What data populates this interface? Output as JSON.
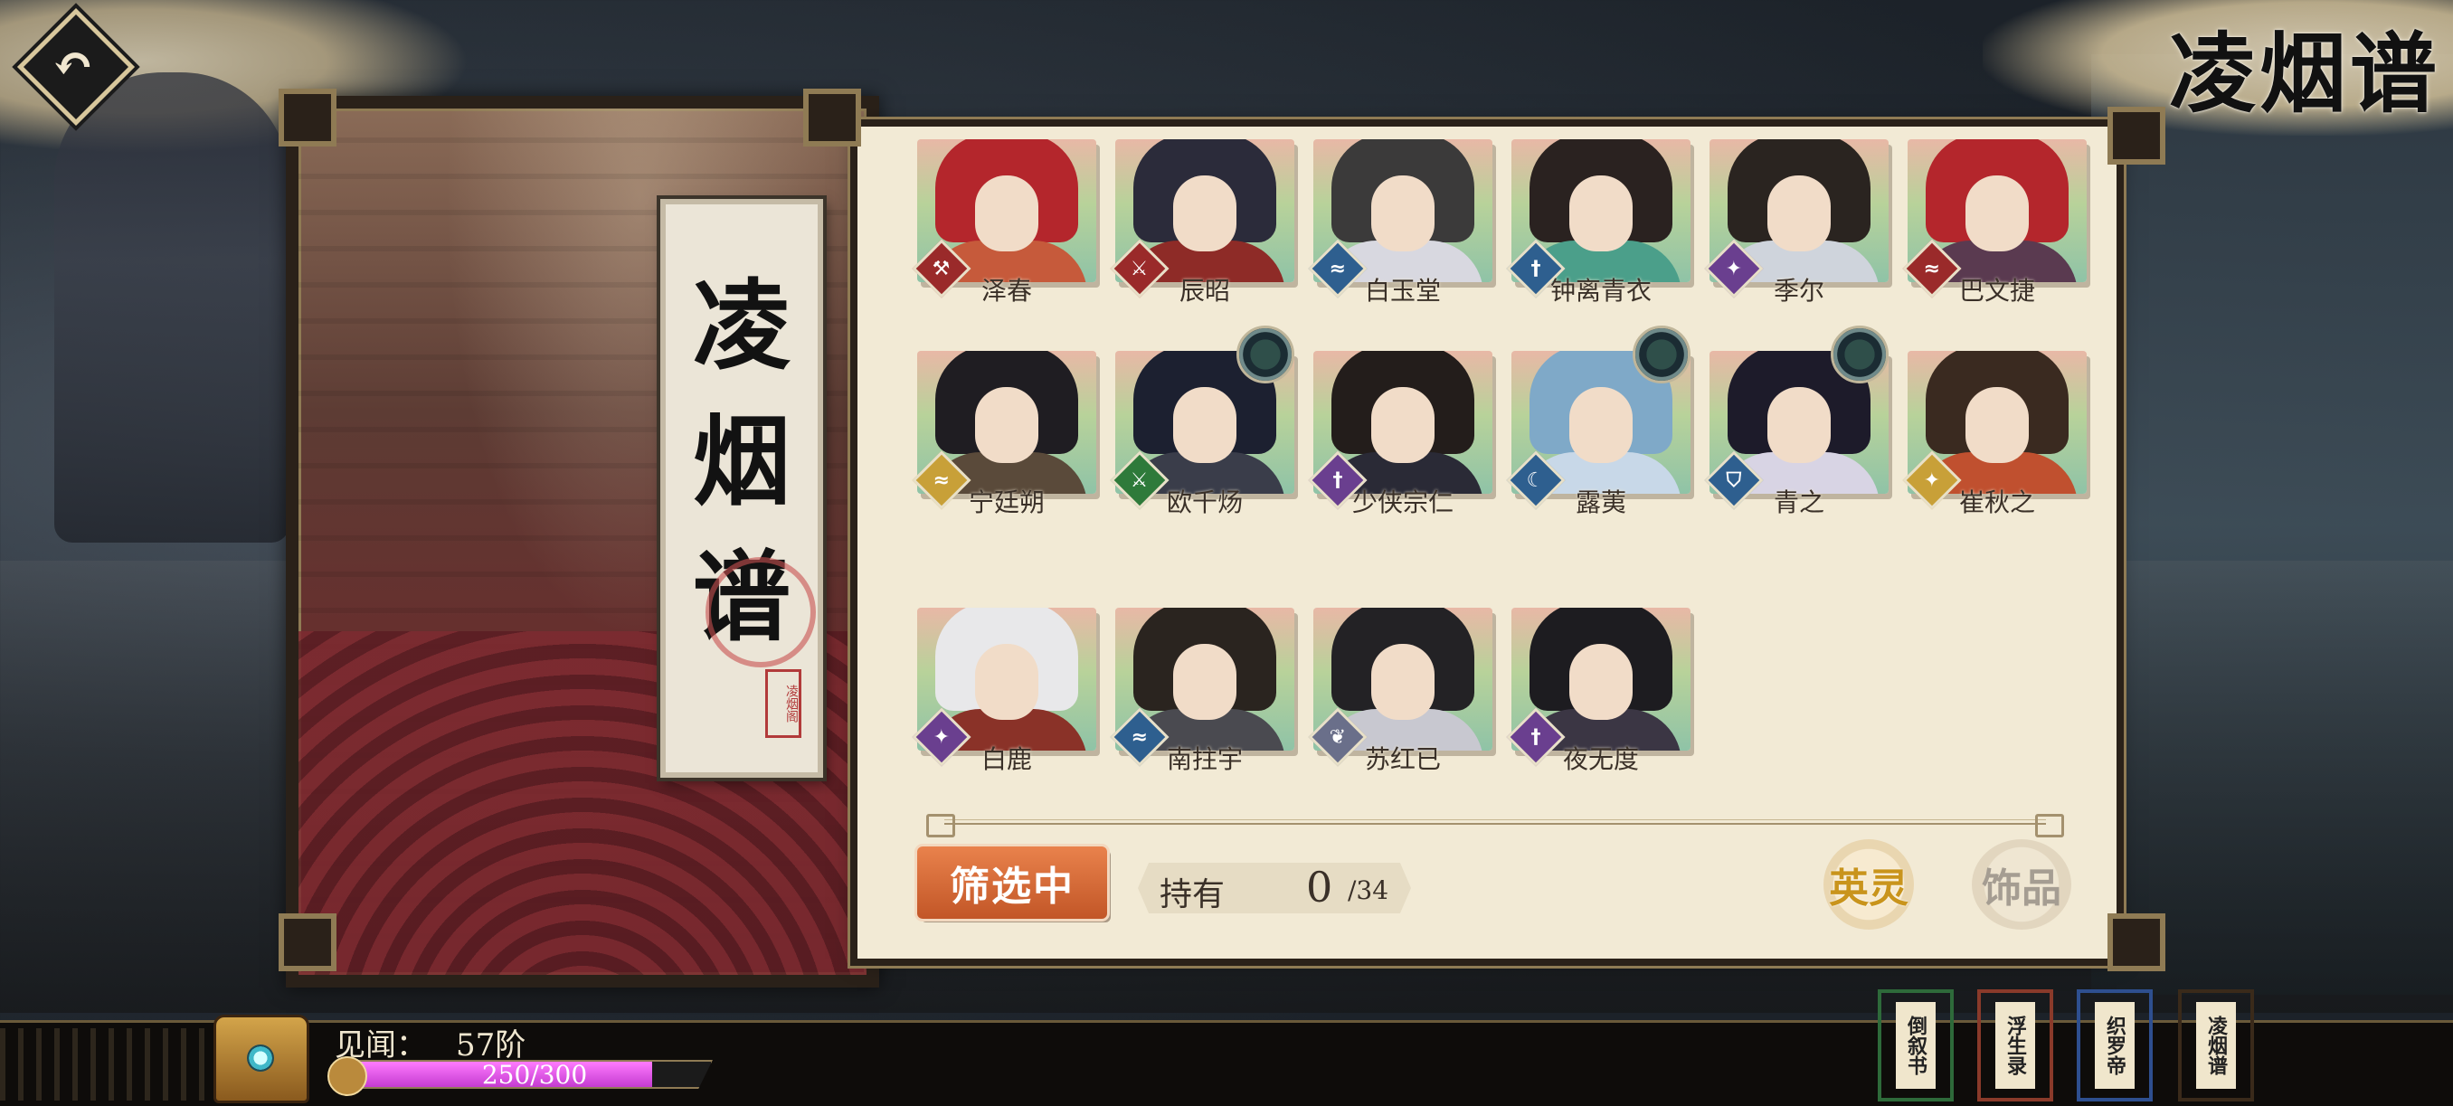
{
  "header": {
    "title": "凌烟谱"
  },
  "left_panel": {
    "title_chars": [
      "凌",
      "烟",
      "谱"
    ],
    "stamp_text": "凌烟阁"
  },
  "cards": [
    {
      "name": "泽春",
      "role_icon": "hammer-icon",
      "role_glyph": "⚒",
      "role_color": "#9a2a2a",
      "hair": "#b4262c",
      "cloth": "#c65a3b",
      "gear": false
    },
    {
      "name": "辰昭",
      "role_icon": "sword-icon",
      "role_glyph": "⚔",
      "role_color": "#9a2a2a",
      "hair": "#2b2b3a",
      "cloth": "#8e2b27",
      "gear": false
    },
    {
      "name": "白玉堂",
      "role_icon": "wave-icon",
      "role_glyph": "≈",
      "role_color": "#2e5f8f",
      "hair": "#3b3a3a",
      "cloth": "#d8d8e0",
      "gear": false
    },
    {
      "name": "钟离青衣",
      "role_icon": "dagger-icon",
      "role_glyph": "†",
      "role_color": "#2e5f8f",
      "hair": "#2a2220",
      "cloth": "#4b9f8a",
      "gear": false
    },
    {
      "name": "季尔",
      "role_icon": "spear-icon",
      "role_glyph": "✦",
      "role_color": "#6a3f8f",
      "hair": "#2a2420",
      "cloth": "#cfd4dc",
      "gear": false
    },
    {
      "name": "巴文捷",
      "role_icon": "wave-icon",
      "role_glyph": "≈",
      "role_color": "#9a2a2a",
      "hair": "#b4262c",
      "cloth": "#5a3a50",
      "gear": false
    },
    {
      "name": "宁廷朔",
      "role_icon": "wave-icon",
      "role_glyph": "≈",
      "role_color": "#c8a038",
      "hair": "#1f1d22",
      "cloth": "#5a4a3a",
      "gear": false
    },
    {
      "name": "欧千炀",
      "role_icon": "sword-icon",
      "role_glyph": "⚔",
      "role_color": "#2e7a3a",
      "hair": "#1c2030",
      "cloth": "#3a3d4a",
      "gear": true
    },
    {
      "name": "少侠宗仁",
      "role_icon": "dagger-icon",
      "role_glyph": "†",
      "role_color": "#6a3f8f",
      "hair": "#231d1b",
      "cloth": "#2a2a36",
      "gear": false
    },
    {
      "name": "露荑",
      "role_icon": "moon-icon",
      "role_glyph": "☾",
      "role_color": "#2e5f8f",
      "hair": "#7fa9c8",
      "cloth": "#c8d8e8",
      "gear": true
    },
    {
      "name": "青之",
      "role_icon": "shield-icon",
      "role_glyph": "⛉",
      "role_color": "#2e5f8f",
      "hair": "#1d1b2a",
      "cloth": "#d8d4e4",
      "gear": true
    },
    {
      "name": "崔秋之",
      "role_icon": "spear-icon",
      "role_glyph": "✦",
      "role_color": "#c8a038",
      "hair": "#3a2a20",
      "cloth": "#c0502f",
      "gear": false
    },
    {
      "name": "白鹿",
      "role_icon": "spear-icon",
      "role_glyph": "✦",
      "role_color": "#6a3f8f",
      "hair": "#e8e8ea",
      "cloth": "#8a3228",
      "gear": false
    },
    {
      "name": "南拄宇",
      "role_icon": "wave-icon",
      "role_glyph": "≈",
      "role_color": "#2e5f8f",
      "hair": "#2a241f",
      "cloth": "#4a4a50",
      "gear": false
    },
    {
      "name": "苏红已",
      "role_icon": "leaf-icon",
      "role_glyph": "❦",
      "role_color": "#6a6f8a",
      "hair": "#232225",
      "cloth": "#c8c8d0",
      "gear": false
    },
    {
      "name": "夜无度",
      "role_icon": "dagger-icon",
      "role_glyph": "†",
      "role_color": "#6a3f8f",
      "hair": "#1d1c20",
      "cloth": "#3b3644",
      "gear": false
    }
  ],
  "footer": {
    "filter_label": "筛选中",
    "owned_label": "持有",
    "owned_value": "0",
    "owned_total": "/34",
    "tab_heroes": "英灵",
    "tab_ornaments": "饰品"
  },
  "status": {
    "xp_label": "见闻：",
    "xp_level": "57阶",
    "xp_text": "250/300",
    "xp_fraction": 0.833
  },
  "books": [
    {
      "label": "倒叙书",
      "border": "#2e6a3a"
    },
    {
      "label": "浮生录",
      "border": "#8a3a2a"
    },
    {
      "label": "织罗帝",
      "border": "#2e4f8f"
    },
    {
      "label": "凌烟谱",
      "border": "#3a2a1a"
    }
  ],
  "colors": {
    "accent_orange": "#d9673a",
    "paper": "#f2ead5",
    "xp_pink": "#e05ae6"
  }
}
